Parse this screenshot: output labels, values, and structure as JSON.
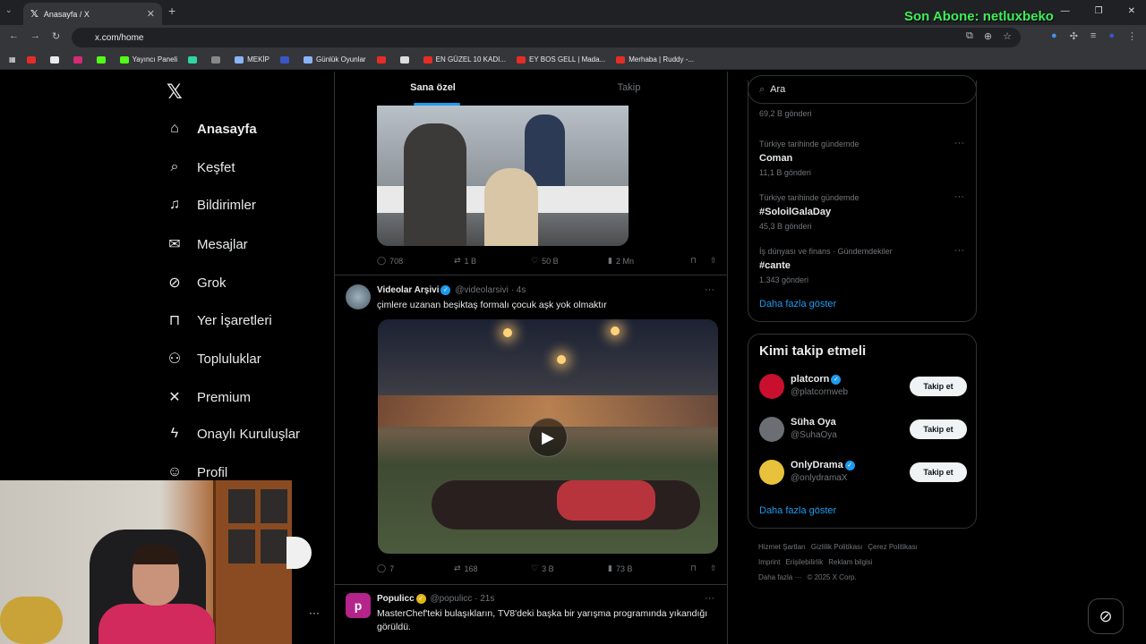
{
  "browser": {
    "tab_title": "Anasayfa / X",
    "url": "x.com/home",
    "overlay_text": "Son Abone: netluxbeko",
    "bookmarks": [
      {
        "label": "",
        "color": "#e52d27"
      },
      {
        "label": "",
        "color": "#e7e9ea"
      },
      {
        "label": "",
        "color": "#d62976"
      },
      {
        "label": "",
        "color": "#53fc18"
      },
      {
        "label": "Yayıncı Paneli",
        "color": "#53fc18"
      },
      {
        "label": "",
        "color": "#2fd6a0"
      },
      {
        "label": "",
        "color": "#888888"
      },
      {
        "label": "MEKİP",
        "color": "#8ab4f8"
      },
      {
        "label": "",
        "color": "#3a55c8"
      },
      {
        "label": "Günlük Oyunlar",
        "color": "#8ab4f8"
      },
      {
        "label": "",
        "color": "#e52d27"
      },
      {
        "label": "",
        "color": "#dddddd"
      },
      {
        "label": "EN GÜZEL 10 KADI...",
        "color": "#e52d27"
      },
      {
        "label": "EY BOS GELL | Mada...",
        "color": "#e52d27"
      },
      {
        "label": "Merhaba | Ruddy -...",
        "color": "#e52d27"
      }
    ]
  },
  "nav": {
    "items": [
      {
        "label": "Anasayfa",
        "icon": "home-icon",
        "glyph": "⌂"
      },
      {
        "label": "Keşfet",
        "icon": "search-icon",
        "glyph": "⌕"
      },
      {
        "label": "Bildirimler",
        "icon": "bell-icon",
        "glyph": "♫"
      },
      {
        "label": "Mesajlar",
        "icon": "mail-icon",
        "glyph": "✉"
      },
      {
        "label": "Grok",
        "icon": "grok-icon",
        "glyph": "⊘"
      },
      {
        "label": "Yer İşaretleri",
        "icon": "bookmark-icon",
        "glyph": "⊓"
      },
      {
        "label": "Topluluklar",
        "icon": "communities-icon",
        "glyph": "⚇"
      },
      {
        "label": "Premium",
        "icon": "x-premium-icon",
        "glyph": "✕"
      },
      {
        "label": "Onaylı Kuruluşlar",
        "icon": "lightning-icon",
        "glyph": "ϟ"
      },
      {
        "label": "Profil",
        "icon": "profile-icon",
        "glyph": "☺"
      }
    ]
  },
  "feed": {
    "tabs": [
      "Sana özel",
      "Takip"
    ],
    "tweet1_actions": {
      "replies": "708",
      "retweets": "1 B",
      "likes": "50 B",
      "views": "2 Mn"
    },
    "tweet2": {
      "name": "Videolar Arşivi",
      "handle": "@videolarsivi",
      "time": "· 4s",
      "text": "çimlere uzanan beşiktaş formalı çocuk aşk yok olmaktır",
      "actions": {
        "replies": "7",
        "retweets": "168",
        "likes": "3 B",
        "views": "73 B"
      }
    },
    "tweet3": {
      "name": "Populicc",
      "handle": "@populicc",
      "time": "· 21s",
      "text": "MasterChef'teki bulaşıkların, TV8'deki başka bir yarışma programında yıkandığı görüldü."
    }
  },
  "sidebar": {
    "search_placeholder": "Ara",
    "trend_top_count": "69,2 B gönderi",
    "trends": [
      {
        "meta": "Türkiye tarihinde gündemde",
        "name": "Coman",
        "count": "11,1 B gönderi"
      },
      {
        "meta": "Türkiye tarihinde gündemde",
        "name": "#SoloilGalaDay",
        "count": "45,3 B gönderi"
      },
      {
        "meta": "İş dünyası ve finans · Gündemdekiler",
        "name": "#cante",
        "count": "1.343 gönderi"
      }
    ],
    "show_more": "Daha fazla göster",
    "who_title": "Kimi takip etmeli",
    "who": [
      {
        "name": "platcorn",
        "handle": "@platcornweb",
        "verified": true,
        "color": "#c8102e"
      },
      {
        "name": "Süha Oya",
        "handle": "@SuhaOya",
        "verified": false,
        "color": "#6b6f73"
      },
      {
        "name": "OnlyDrama",
        "handle": "@onlydramaX",
        "verified": true,
        "color": "#e7c23a"
      }
    ],
    "follow_label": "Takip et",
    "who_show_more": "Daha fazla göster",
    "footer": [
      "Hizmet Şartları",
      "Gizlilik Politikası",
      "Çerez Politikası",
      "Imprint",
      "Erişilebilirlik",
      "Reklam bilgisi",
      "Daha fazla ···",
      "© 2025 X Corp."
    ]
  }
}
